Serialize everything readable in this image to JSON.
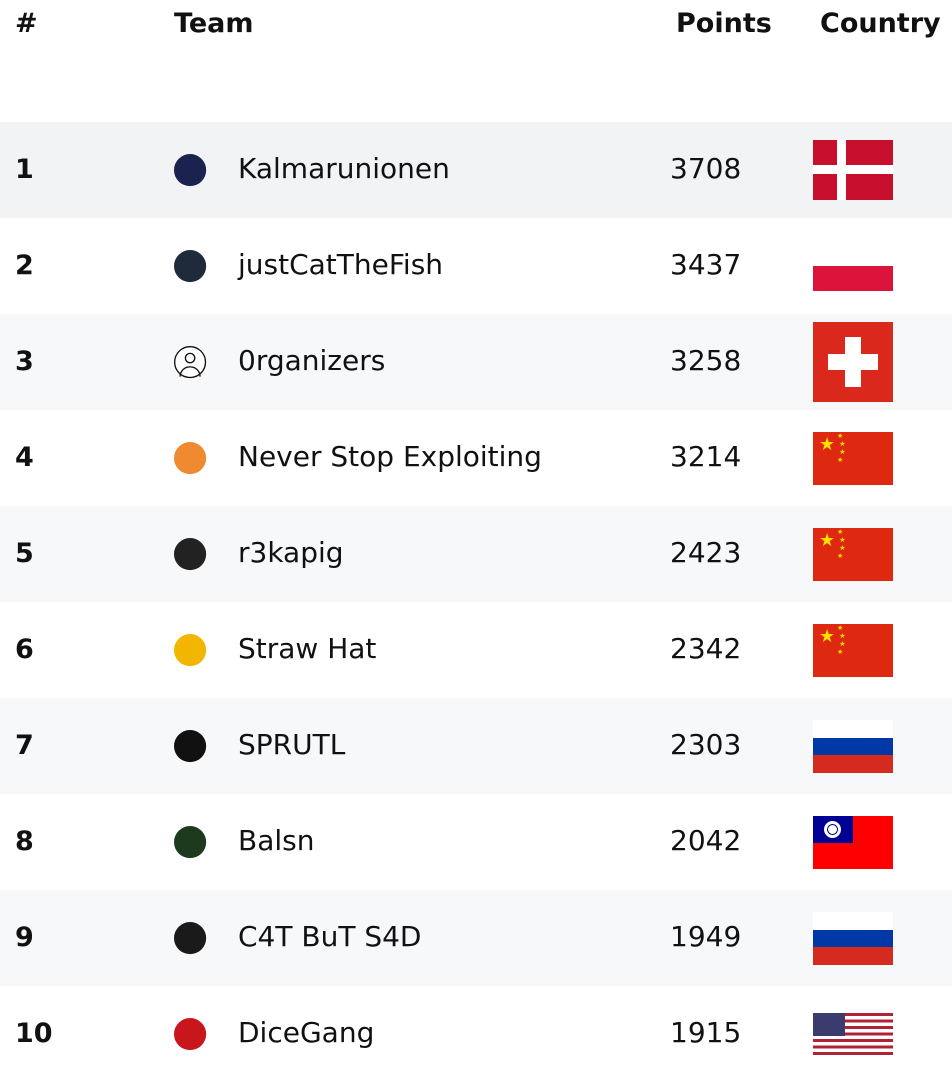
{
  "header": {
    "rank": "#",
    "team": "Team",
    "points": "Points",
    "country": "Country"
  },
  "rows": [
    {
      "rank": "1",
      "team": "Kalmarunionen",
      "points": "3708",
      "country_flag": "denmark",
      "logo": "kalmarunionen-logo",
      "logo_color": "#1a2350"
    },
    {
      "rank": "2",
      "team": "justCatTheFish",
      "points": "3437",
      "country_flag": "poland",
      "logo": "justcatthefish-logo",
      "logo_color": "#1f2a3a"
    },
    {
      "rank": "3",
      "team": "0rganizers",
      "points": "3258",
      "country_flag": "switzerland",
      "logo": "user-avatar-icon",
      "logo_color": "#ffffff"
    },
    {
      "rank": "4",
      "team": "Never Stop Exploiting",
      "points": "3214",
      "country_flag": "china",
      "logo": "never-stop-exploiting-logo",
      "logo_color": "#f08a30"
    },
    {
      "rank": "5",
      "team": "r3kapig",
      "points": "2423",
      "country_flag": "china",
      "logo": "r3kapig-logo",
      "logo_color": "#222222"
    },
    {
      "rank": "6",
      "team": "Straw Hat",
      "points": "2342",
      "country_flag": "china",
      "logo": "straw-hat-logo",
      "logo_color": "#f2b600"
    },
    {
      "rank": "7",
      "team": "SPRUTL",
      "points": "2303",
      "country_flag": "russia",
      "logo": "sprutl-logo",
      "logo_color": "#111111"
    },
    {
      "rank": "8",
      "team": "Balsn",
      "points": "2042",
      "country_flag": "taiwan",
      "logo": "balsn-logo",
      "logo_color": "#1e3a1e"
    },
    {
      "rank": "9",
      "team": "C4T BuT S4D",
      "points": "1949",
      "country_flag": "russia",
      "logo": "c4t-but-s4d-logo",
      "logo_color": "#1a1a1a"
    },
    {
      "rank": "10",
      "team": "DiceGang",
      "points": "1915",
      "country_flag": "usa",
      "logo": "dicegang-logo",
      "logo_color": "#c8161d"
    }
  ]
}
